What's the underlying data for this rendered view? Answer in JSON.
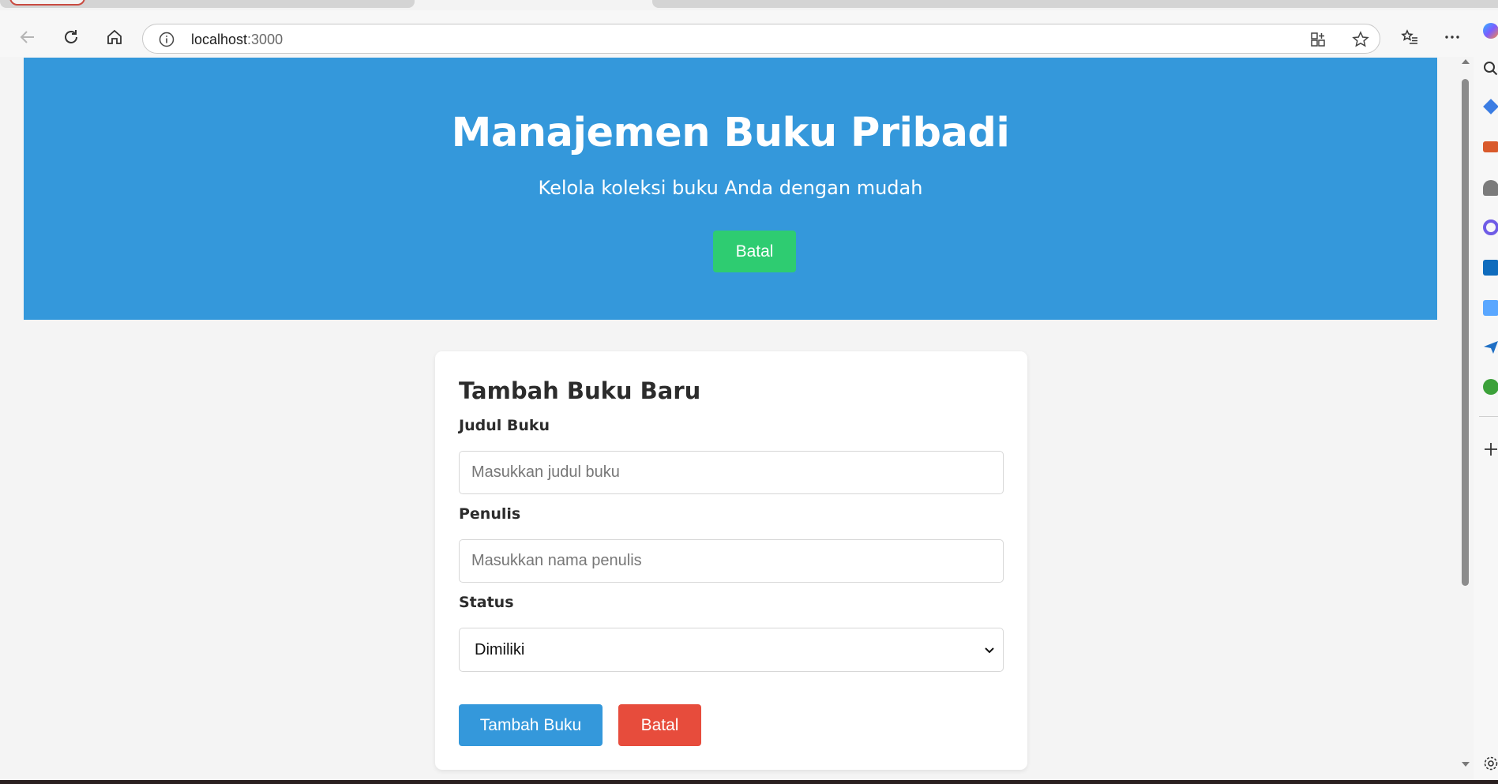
{
  "browser": {
    "url_host": "localhost",
    "url_port": ":3000"
  },
  "header": {
    "title": "Manajemen Buku Pribadi",
    "subtitle": "Kelola koleksi buku Anda dengan mudah",
    "toggle_button": "Batal"
  },
  "form": {
    "heading": "Tambah Buku Baru",
    "title_label": "Judul Buku",
    "title_placeholder": "Masukkan judul buku",
    "author_label": "Penulis",
    "author_placeholder": "Masukkan nama penulis",
    "status_label": "Status",
    "status_value": "Dimiliki",
    "submit_label": "Tambah Buku",
    "cancel_label": "Batal"
  },
  "colors": {
    "hero": "#3498db",
    "toggle_button": "#2ecc71",
    "submit_button": "#3498db",
    "cancel_button": "#e74c3c"
  }
}
